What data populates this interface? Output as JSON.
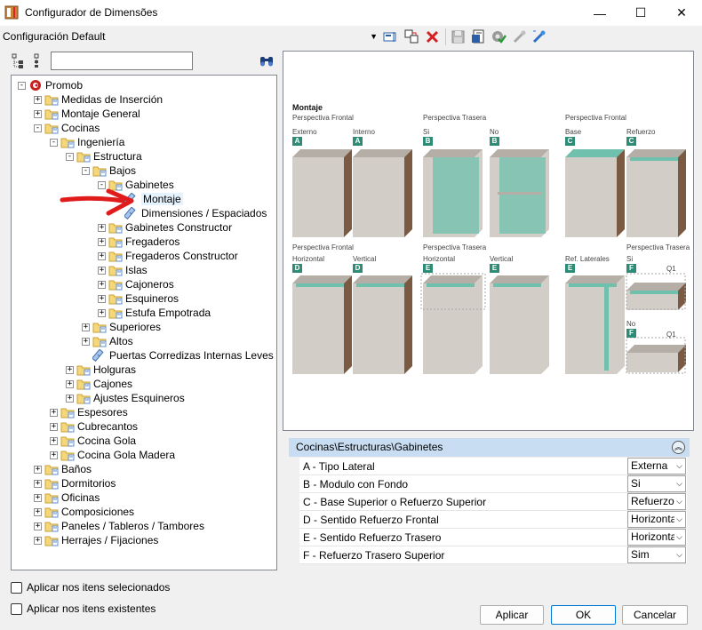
{
  "window": {
    "title": "Configurador de Dimensões",
    "minimize_glyph": "—",
    "maximize_glyph": "☐",
    "close_glyph": "✕"
  },
  "toolbar": {
    "configuration": "Configuración Default",
    "icons": [
      "edit-config-icon",
      "copy-config-icon",
      "delete-icon",
      "save-icon",
      "export-icon",
      "apply-check-icon",
      "tool-icon",
      "wand-icon"
    ]
  },
  "tree_tools": {
    "search_value": "",
    "expand_icon": "expand-tree-icon",
    "collapse_icon": "collapse-tree-icon",
    "find_icon": "binoculars-icon"
  },
  "tree": [
    {
      "label": "Promob",
      "level": 0,
      "type": "root",
      "expander": "-"
    },
    {
      "label": "Medidas de Inserción",
      "level": 1,
      "type": "folder",
      "expander": "+"
    },
    {
      "label": "Montaje General",
      "level": 1,
      "type": "folder",
      "expander": "+"
    },
    {
      "label": "Cocinas",
      "level": 1,
      "type": "folder",
      "expander": "-"
    },
    {
      "label": "Ingeniería",
      "level": 2,
      "type": "folder",
      "expander": "-"
    },
    {
      "label": "Estructura",
      "level": 3,
      "type": "folder",
      "expander": "-"
    },
    {
      "label": "Bajos",
      "level": 4,
      "type": "folder",
      "expander": "-"
    },
    {
      "label": "Gabinetes",
      "level": 5,
      "type": "folder",
      "expander": "-"
    },
    {
      "label": "Montaje",
      "level": 6,
      "type": "item",
      "expander": "",
      "selected": true
    },
    {
      "label": "Dimensiones / Espaciados",
      "level": 6,
      "type": "item",
      "expander": ""
    },
    {
      "label": "Gabinetes Constructor",
      "level": 5,
      "type": "folder",
      "expander": "+"
    },
    {
      "label": "Fregaderos",
      "level": 5,
      "type": "folder",
      "expander": "+"
    },
    {
      "label": "Fregaderos Constructor",
      "level": 5,
      "type": "folder",
      "expander": "+"
    },
    {
      "label": "Islas",
      "level": 5,
      "type": "folder",
      "expander": "+"
    },
    {
      "label": "Cajoneros",
      "level": 5,
      "type": "folder",
      "expander": "+"
    },
    {
      "label": "Esquineros",
      "level": 5,
      "type": "folder",
      "expander": "+"
    },
    {
      "label": "Estufa Empotrada",
      "level": 5,
      "type": "folder",
      "expander": "+"
    },
    {
      "label": "Superiores",
      "level": 4,
      "type": "folder",
      "expander": "+"
    },
    {
      "label": "Altos",
      "level": 4,
      "type": "folder",
      "expander": "+"
    },
    {
      "label": "Puertas Corredizas Internas Leves",
      "level": 4,
      "type": "item",
      "expander": ""
    },
    {
      "label": "Holguras",
      "level": 3,
      "type": "folder",
      "expander": "+"
    },
    {
      "label": "Cajones",
      "level": 3,
      "type": "folder",
      "expander": "+"
    },
    {
      "label": "Ajustes Esquineros",
      "level": 3,
      "type": "folder",
      "expander": "+"
    },
    {
      "label": "Espesores",
      "level": 2,
      "type": "folder",
      "expander": "+"
    },
    {
      "label": "Cubrecantos",
      "level": 2,
      "type": "folder",
      "expander": "+"
    },
    {
      "label": "Cocina Gola",
      "level": 2,
      "type": "folder",
      "expander": "+"
    },
    {
      "label": "Cocina Gola Madera",
      "level": 2,
      "type": "folder",
      "expander": "+"
    },
    {
      "label": "Baños",
      "level": 1,
      "type": "folder",
      "expander": "+"
    },
    {
      "label": "Dormitorios",
      "level": 1,
      "type": "folder",
      "expander": "+"
    },
    {
      "label": "Oficinas",
      "level": 1,
      "type": "folder",
      "expander": "+"
    },
    {
      "label": "Composiciones",
      "level": 1,
      "type": "folder",
      "expander": "+"
    },
    {
      "label": "Paneles / Tableros / Tambores",
      "level": 1,
      "type": "folder",
      "expander": "+"
    },
    {
      "label": "Herrajes / Fijaciones",
      "level": 1,
      "type": "folder",
      "expander": "+"
    }
  ],
  "checkboxes": {
    "apply_selected": "Aplicar nos itens selecionados",
    "apply_existing": "Aplicar nos itens existentes"
  },
  "preview": {
    "title": "Montaje",
    "row1": [
      {
        "persp": "Perspectiva Frontal",
        "label": "Externo",
        "badge": "A"
      },
      {
        "persp": "",
        "label": "Interno",
        "badge": "A"
      },
      {
        "persp": "Perspectiva Trasera",
        "label": "Si",
        "badge": "B"
      },
      {
        "persp": "",
        "label": "No",
        "badge": "B"
      },
      {
        "persp": "Perspectiva Frontal",
        "label": "Base",
        "badge": "C"
      },
      {
        "persp": "",
        "label": "Refuerzo",
        "badge": "C"
      }
    ],
    "row2": [
      {
        "persp": "Perspectiva Frontal",
        "label": "Horizontal",
        "badge": "D"
      },
      {
        "persp": "",
        "label": "Vertical",
        "badge": "D"
      },
      {
        "persp": "Perspectiva Trasera",
        "label": "Horizontal",
        "badge": "E"
      },
      {
        "persp": "",
        "label": "Vertical",
        "badge": "E"
      },
      {
        "persp": "",
        "label": "Ref. Laterales",
        "badge": "E"
      },
      {
        "persp": "Perspectiva Trasera",
        "label": "Si",
        "badge": "F"
      }
    ],
    "row3": {
      "label": "No",
      "badge": "F"
    },
    "small_label": "Q1",
    "colors": {
      "wood": "#7a5a42",
      "gray": "#d2cdc6",
      "gray_dark": "#b4aea6",
      "teal": "#6fc0ad",
      "badge": "#2e8b76"
    }
  },
  "properties": {
    "header": "Cocinas\\Estructuras\\Gabinetes",
    "rows": [
      {
        "name": "A - Tipo Lateral",
        "value": "Externa"
      },
      {
        "name": "B - Modulo con Fondo",
        "value": "Si"
      },
      {
        "name": "C - Base Superior o Refuerzo Superior",
        "value": "Refuerzo"
      },
      {
        "name": "D - Sentido Refuerzo Frontal",
        "value": "Horizonta"
      },
      {
        "name": "E - Sentido Refuerzo Trasero",
        "value": "Horizonta"
      },
      {
        "name": "F - Refuerzo Trasero Superior",
        "value": "Sim"
      }
    ]
  },
  "buttons": {
    "apply": "Aplicar",
    "ok": "OK",
    "cancel": "Cancelar"
  }
}
